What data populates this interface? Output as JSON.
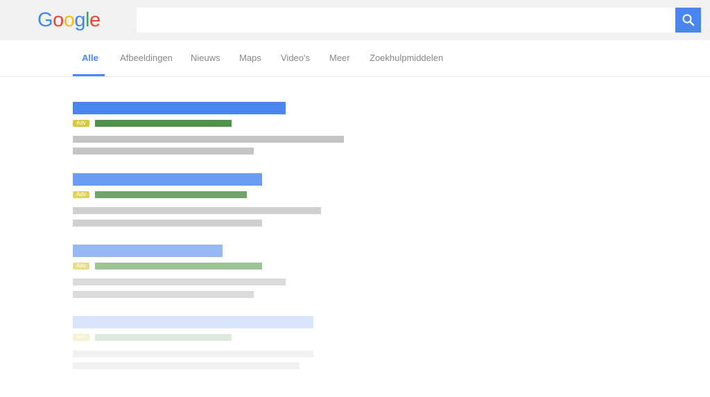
{
  "logo": {
    "text": "Google",
    "letters": [
      "G",
      "o",
      "o",
      "g",
      "l",
      "e"
    ]
  },
  "search": {
    "value": "",
    "placeholder": ""
  },
  "tabs": [
    {
      "label": "Alle",
      "active": true
    },
    {
      "label": "Afbeeldingen",
      "active": false
    },
    {
      "label": "Nieuws",
      "active": false
    },
    {
      "label": "Maps",
      "active": false
    },
    {
      "label": "Video's",
      "active": false
    },
    {
      "label": "Meer",
      "active": false
    },
    {
      "label": "Zoekhulpmiddelen",
      "active": false
    }
  ],
  "results": [
    {
      "badge": "Adv"
    },
    {
      "badge": "Adv"
    },
    {
      "badge": "Adv"
    },
    {
      "badge": "Adv"
    }
  ],
  "colors": {
    "accent": "#4a86f0",
    "logo": [
      "#4285f4",
      "#ea4335",
      "#fbbc05",
      "#4285f4",
      "#34a853",
      "#ea4335"
    ]
  },
  "icons": {
    "search_button": "search-icon"
  }
}
